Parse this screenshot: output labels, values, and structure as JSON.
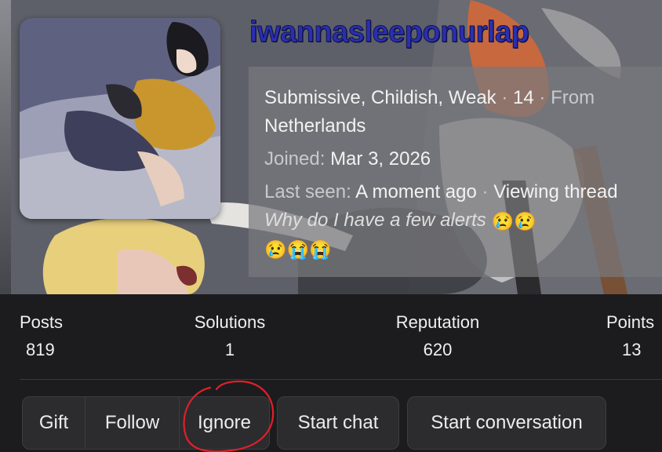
{
  "profile": {
    "username": "iwannasleeponurlap",
    "info": {
      "titles": "Submissive, Childish, Weak",
      "age": "14",
      "from_prefix": "From",
      "location": "Netherlands",
      "joined_label": "Joined:",
      "joined_value": "Mar 3, 2026",
      "last_seen_label": "Last seen:",
      "last_seen_value": "A moment ago",
      "activity_prefix": "Viewing thread",
      "activity_thread": "Why do I have a few alerts",
      "emojis_line1": "😢😢",
      "emojis_line2": "😢😭😭"
    }
  },
  "stats": [
    {
      "label": "Posts",
      "value": "819"
    },
    {
      "label": "Solutions",
      "value": "1"
    },
    {
      "label": "Reputation",
      "value": "620"
    },
    {
      "label": "Points",
      "value": "13"
    }
  ],
  "actions": {
    "gift": "Gift",
    "follow": "Follow",
    "ignore": "Ignore",
    "start_chat": "Start chat",
    "start_conversation": "Start conversation"
  },
  "colors": {
    "username": "#2a2fb0",
    "annotation_circle": "#e0202a",
    "background": "#1c1c1e"
  }
}
